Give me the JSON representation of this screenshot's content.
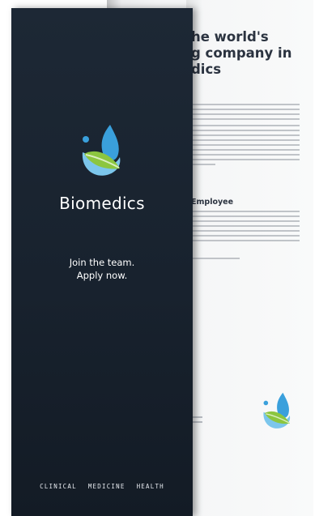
{
  "front": {
    "brand_name": "Biomedics",
    "tagline_line1": "Join the team.",
    "tagline_line2": "Apply now.",
    "footer_tags": [
      "CLINICAL",
      "MEDICINE",
      "HEALTH"
    ]
  },
  "back": {
    "headline": "he world's\ng company in\ndics",
    "subheading": "Employee"
  },
  "colors": {
    "front_bg": "#1b2531",
    "logo_blue": "#3aa0dc",
    "logo_light_blue": "#7cc6ec",
    "logo_green": "#8cc63f",
    "text_dark": "#2b3340"
  }
}
